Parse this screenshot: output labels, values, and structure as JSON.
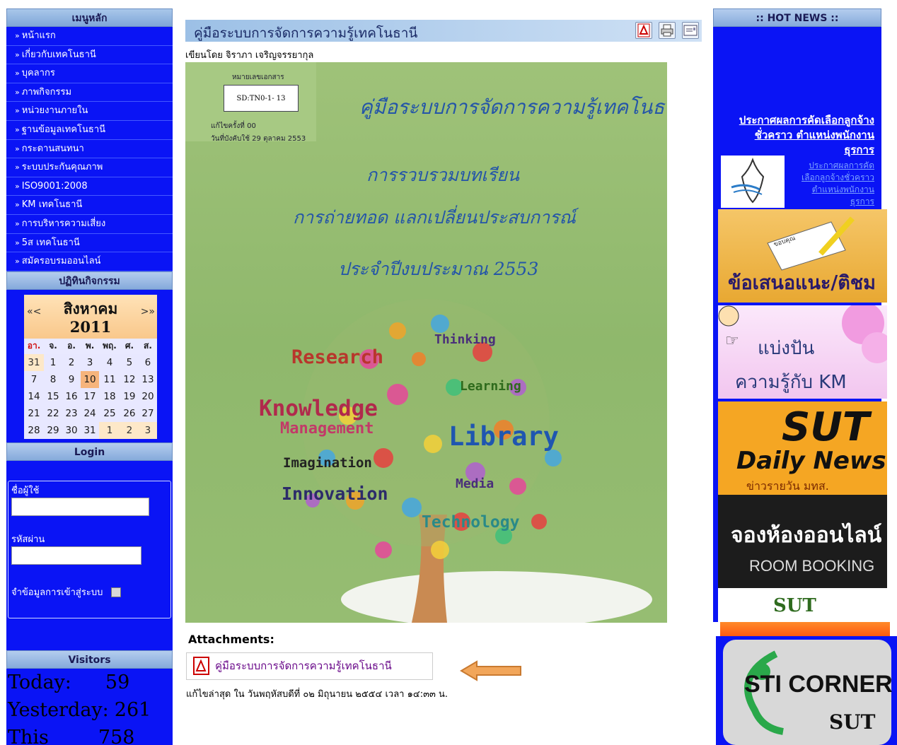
{
  "left": {
    "main_menu_title": "เมนูหลัก",
    "menu": [
      {
        "label": "หน้าแรก"
      },
      {
        "label": "เกี่ยวกับเทคโนธานี"
      },
      {
        "label": "บุคลากร"
      },
      {
        "label": "ภาพกิจกรรม"
      },
      {
        "label": "หน่วยงานภายใน"
      },
      {
        "label": "ฐานข้อมูลเทคโนธานี"
      },
      {
        "label": "กระดานสนทนา"
      },
      {
        "label": "ระบบประกันคุณภาพ"
      },
      {
        "label": "ISO9001:2008"
      },
      {
        "label": "KM เทคโนธานี"
      },
      {
        "label": "การบริหารความเสี่ยง"
      },
      {
        "label": "5ส เทคโนธานี"
      },
      {
        "label": "สมัครอบรมออนไลน์"
      }
    ],
    "calendar_title": "ปฏิทินกิจกรรม",
    "calendar": {
      "month": "สิงหาคม",
      "year": "2011",
      "prev": "«<",
      "next": ">»",
      "weekdays": [
        "อา.",
        "จ.",
        "อ.",
        "พ.",
        "พฤ.",
        "ศ.",
        "ส."
      ],
      "weeks": [
        [
          "31",
          "1",
          "2",
          "3",
          "4",
          "5",
          "6"
        ],
        [
          "7",
          "8",
          "9",
          "10",
          "11",
          "12",
          "13"
        ],
        [
          "14",
          "15",
          "16",
          "17",
          "18",
          "19",
          "20"
        ],
        [
          "21",
          "22",
          "23",
          "24",
          "25",
          "26",
          "27"
        ],
        [
          "28",
          "29",
          "30",
          "31",
          "1",
          "2",
          "3"
        ]
      ],
      "today": "10"
    },
    "login_title": "Login",
    "login": {
      "username_label": "ชื่อผู้ใช้",
      "password_label": "รหัสผ่าน",
      "remember_label": "จำข้อมูลการเข้าสู่ระบบ"
    },
    "visitors_title": "Visitors",
    "visitors": [
      {
        "label": "Today:",
        "value": "59"
      },
      {
        "label": "Yesterday:",
        "value": "261"
      },
      {
        "label": "This",
        "value": "758"
      }
    ]
  },
  "article": {
    "title": "คู่มือระบบการจัดการความรู้เทคโนธานี",
    "byline": "เขียนโดย จิราภา เจริญจรรยากุล",
    "cover": {
      "doc_label_head": "หมายเลขเอกสาร",
      "doc_number": "SD:TN0-1- 13",
      "revision": "แก้ไขครั้งที่     00",
      "effective": "วันที่บังคับใช้ 29 ตุลาคม 2553",
      "title": "คู่มือระบบการจัดการความรู้เทคโนธานี",
      "line1": "การรวบรวมบทเรียน",
      "line2": "การถ่ายทอด แลกเปลี่ยนประสบการณ์",
      "line3": "ประจำปีงบประมาณ 2553",
      "words": [
        "Research",
        "Thinking",
        "Learning",
        "Knowledge",
        "Management",
        "Library",
        "Imagination",
        "Media",
        "Innovation",
        "Technology"
      ]
    },
    "attachments_title": "Attachments:",
    "attachment_name": "คู่มือระบบการจัดการความรู้เทคโนธานี",
    "last_modified": "แก้ไขล่าสุด ใน วันพฤหัสบดีที่ ๐๒ มิถุนายน ๒๕๕๔ เวลา ๑๔:๓๓ น."
  },
  "right": {
    "hot_news_title": ":: HOT NEWS ::",
    "hot_link": "ประกาศผลการคัดเลือกลูกจ้างชั่วคราว ตำแหน่งพนักงานธุรการ",
    "hot_sub": "ประกาศผลการคัดเลือกลูกจ้างชั่วคราว ตำแหน่งพนักงานธุรการ",
    "banners": {
      "suggest_text": "ข้อเสนอแนะ/ติชม",
      "suggest_note": "ขอบคุณ",
      "km_line1": "แบ่งปัน",
      "km_line2": "ความรู้กับ KM",
      "daily_title1": "SUT",
      "daily_title2": "Daily News",
      "daily_sub": "ข่าวรายวัน มทส.",
      "room_title": "จองห้องออนไลน์",
      "room_sub": "ROOM BOOKING",
      "sut": "SUT",
      "sti_title": "STI CORNER",
      "sti_sub": "SUT"
    }
  },
  "colors": {
    "sidebar_blue": "#0a14f5",
    "header_gradient": "#9cc0e6",
    "cover_green": "#9fc279",
    "link_purple": "#6a0a8a"
  }
}
